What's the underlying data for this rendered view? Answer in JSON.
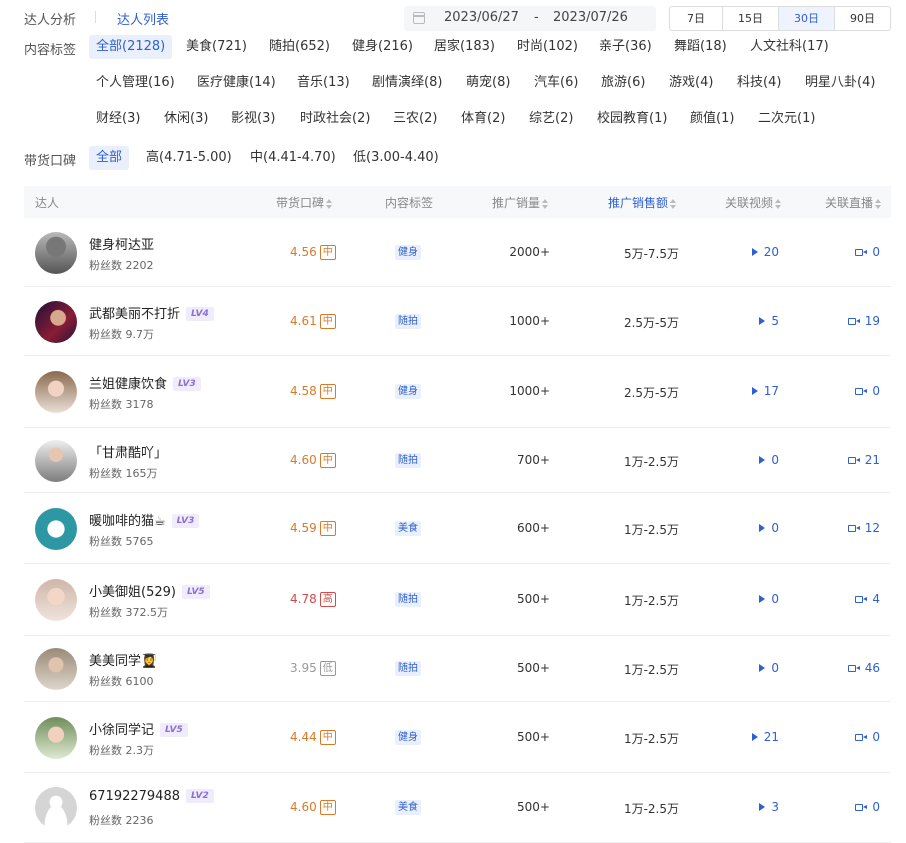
{
  "breadcrumb": {
    "analysis": "达人分析",
    "list": "达人列表"
  },
  "date_range": {
    "start": "2023/06/27",
    "separator": "-",
    "end": "2023/07/26"
  },
  "range_buttons": [
    {
      "label": "7日",
      "active": false
    },
    {
      "label": "15日",
      "active": false
    },
    {
      "label": "30日",
      "active": true
    },
    {
      "label": "90日",
      "active": false
    }
  ],
  "content_filter": {
    "label": "内容标签",
    "tags": [
      "全部(2128)",
      "美食(721)",
      "随拍(652)",
      "健身(216)",
      "居家(183)",
      "时尚(102)",
      "亲子(36)",
      "舞蹈(18)",
      "人文社科(17)",
      "个人管理(16)",
      "医疗健康(14)",
      "音乐(13)",
      "剧情演绎(8)",
      "萌宠(8)",
      "汽车(6)",
      "旅游(6)",
      "游戏(4)",
      "科技(4)",
      "明星八卦(4)",
      "财经(3)",
      "休闲(3)",
      "影视(3)",
      "时政社会(2)",
      "三农(2)",
      "体育(2)",
      "综艺(2)",
      "校园教育(1)",
      "颜值(1)",
      "二次元(1)"
    ],
    "active_index": 0
  },
  "reputation_filter": {
    "label": "带货口碑",
    "options": [
      "全部",
      "高(4.71-5.00)",
      "中(4.41-4.70)",
      "低(3.00-4.40)"
    ],
    "active_index": 0
  },
  "table": {
    "headers": {
      "influencer": "达人",
      "reputation": "带货口碑",
      "content_tag": "内容标签",
      "sales_volume": "推广销量",
      "sales_amount": "推广销售额",
      "videos": "关联视频",
      "lives": "关联直播"
    },
    "rows": [
      {
        "name": "健身柯达亚",
        "lv": "",
        "fans": "粉丝数 2202",
        "score": "4.56",
        "level": "中",
        "tag": "健身",
        "sales": "2000+",
        "gmv": "5万-7.5万",
        "videos": "20",
        "lives": "0"
      },
      {
        "name": "武都美丽不打折",
        "lv": "LV4",
        "fans": "粉丝数 9.7万",
        "score": "4.61",
        "level": "中",
        "tag": "随拍",
        "sales": "1000+",
        "gmv": "2.5万-5万",
        "videos": "5",
        "lives": "19"
      },
      {
        "name": "兰姐健康饮食",
        "lv": "LV3",
        "fans": "粉丝数 3178",
        "score": "4.58",
        "level": "中",
        "tag": "健身",
        "sales": "1000+",
        "gmv": "2.5万-5万",
        "videos": "17",
        "lives": "0"
      },
      {
        "name": "「甘肃酷吖」",
        "lv": "",
        "fans": "粉丝数 165万",
        "score": "4.60",
        "level": "中",
        "tag": "随拍",
        "sales": "700+",
        "gmv": "1万-2.5万",
        "videos": "0",
        "lives": "21"
      },
      {
        "name": "暖咖啡的猫☕",
        "lv": "LV3",
        "fans": "粉丝数 5765",
        "score": "4.59",
        "level": "中",
        "tag": "美食",
        "sales": "600+",
        "gmv": "1万-2.5万",
        "videos": "0",
        "lives": "12"
      },
      {
        "name": "小美御姐(529)",
        "lv": "LV5",
        "fans": "粉丝数 372.5万",
        "score": "4.78",
        "level": "高",
        "tag": "随拍",
        "sales": "500+",
        "gmv": "1万-2.5万",
        "videos": "0",
        "lives": "4"
      },
      {
        "name": "美美同学👩‍🎓",
        "lv": "",
        "fans": "粉丝数 6100",
        "score": "3.95",
        "level": "低",
        "tag": "随拍",
        "sales": "500+",
        "gmv": "1万-2.5万",
        "videos": "0",
        "lives": "46"
      },
      {
        "name": "小徐同学记",
        "lv": "LV5",
        "fans": "粉丝数 2.3万",
        "score": "4.44",
        "level": "中",
        "tag": "健身",
        "sales": "500+",
        "gmv": "1万-2.5万",
        "videos": "21",
        "lives": "0"
      },
      {
        "name": "67192279488",
        "lv": "LV2",
        "fans": "粉丝数 2236",
        "score": "4.60",
        "level": "中",
        "tag": "美食",
        "sales": "500+",
        "gmv": "1万-2.5万",
        "videos": "3",
        "lives": "0"
      }
    ]
  },
  "colors": {
    "accent": "#2f5fd0",
    "mid": "#d97a2b",
    "high": "#d24a4a",
    "low": "#999999"
  }
}
